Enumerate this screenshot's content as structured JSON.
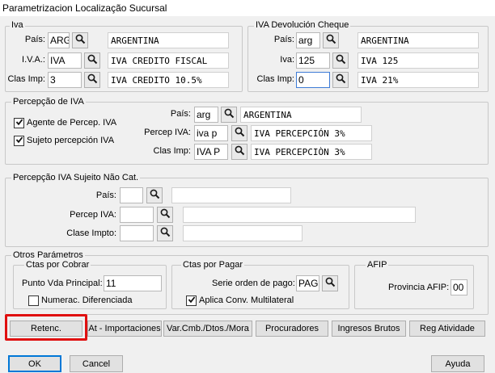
{
  "window": {
    "title": "Parametrizacion Localização Sucursal"
  },
  "iva": {
    "legend": "Iva",
    "pais_label": "País:",
    "pais_code": "ARG",
    "pais_name": "ARGENTINA",
    "iva_label": "I.V.A.:",
    "iva_code": "IVA",
    "iva_name": "IVA   CREDITO FISCAL",
    "clas_label": "Clas Imp:",
    "clas_code": "3",
    "clas_name": "IVA CREDITO 10.5%"
  },
  "iva_devolucion": {
    "legend": "IVA Devolución Cheque",
    "pais_label": "País:",
    "pais_code": "arg",
    "pais_name": "ARGENTINA",
    "iva_label": "Iva:",
    "iva_code": "125",
    "iva_name": "IVA 125",
    "clas_label": "Clas Imp:",
    "clas_code": "0",
    "clas_name": "IVA 21%"
  },
  "percepcion_iva": {
    "legend": "Percepção de IVA",
    "agente_label": "Agente de Percep. IVA",
    "agente_checked": true,
    "sujeto_label": "Sujeto percepción IVA",
    "sujeto_checked": true,
    "pais_label": "País:",
    "pais_code": "arg",
    "pais_name": "ARGENTINA",
    "percep_label": "Percep IVA:",
    "percep_code": "iva p",
    "percep_name": "IVA PERCEPCIÓN 3%",
    "clas_label": "Clas Imp:",
    "clas_code": "IVA P",
    "clas_name": "IVA PERCEPCIÒN  3%"
  },
  "percepcion_sujeto": {
    "legend": "Percepção IVA Sujeito Não Cat.",
    "pais_label": "País:",
    "pais_code": "",
    "pais_name": "",
    "percep_label": "Percep IVA:",
    "percep_code": "",
    "percep_name": "",
    "clase_label": "Clase Impto:",
    "clase_code": "",
    "clase_name": ""
  },
  "otros": {
    "legend": "Otros Parámetros",
    "cobrar": {
      "legend": "Ctas por Cobrar",
      "punto_label": "Punto Vda Principal:",
      "punto_value": "11",
      "numerac_label": "Numerac. Diferenciada",
      "numerac_checked": false
    },
    "pagar": {
      "legend": "Ctas por Pagar",
      "serie_label": "Serie orden de pago:",
      "serie_value": "PAG",
      "aplica_label": "Aplica Conv. Multilateral",
      "aplica_checked": true
    },
    "afip": {
      "legend": "AFIP",
      "provincia_label": "Provincia AFIP:",
      "provincia_value": "00"
    }
  },
  "tabs_buttons": {
    "retenc": "Retenc.",
    "importaciones": "At - Importaciones",
    "varcmb": "Var.Cmb./Dtos./Mora",
    "procuradores": "Procuradores",
    "ingresos": "Ingresos Brutos",
    "reg": "Reg Atividade"
  },
  "footer": {
    "ok": "OK",
    "cancel": "Cancel",
    "help": "Ayuda"
  },
  "colors": {
    "highlight": "#e01010",
    "focus_border": "#3d7bd6",
    "background": "#f0f0f0"
  },
  "icons": {
    "search": "search-icon",
    "check": "check-icon"
  }
}
